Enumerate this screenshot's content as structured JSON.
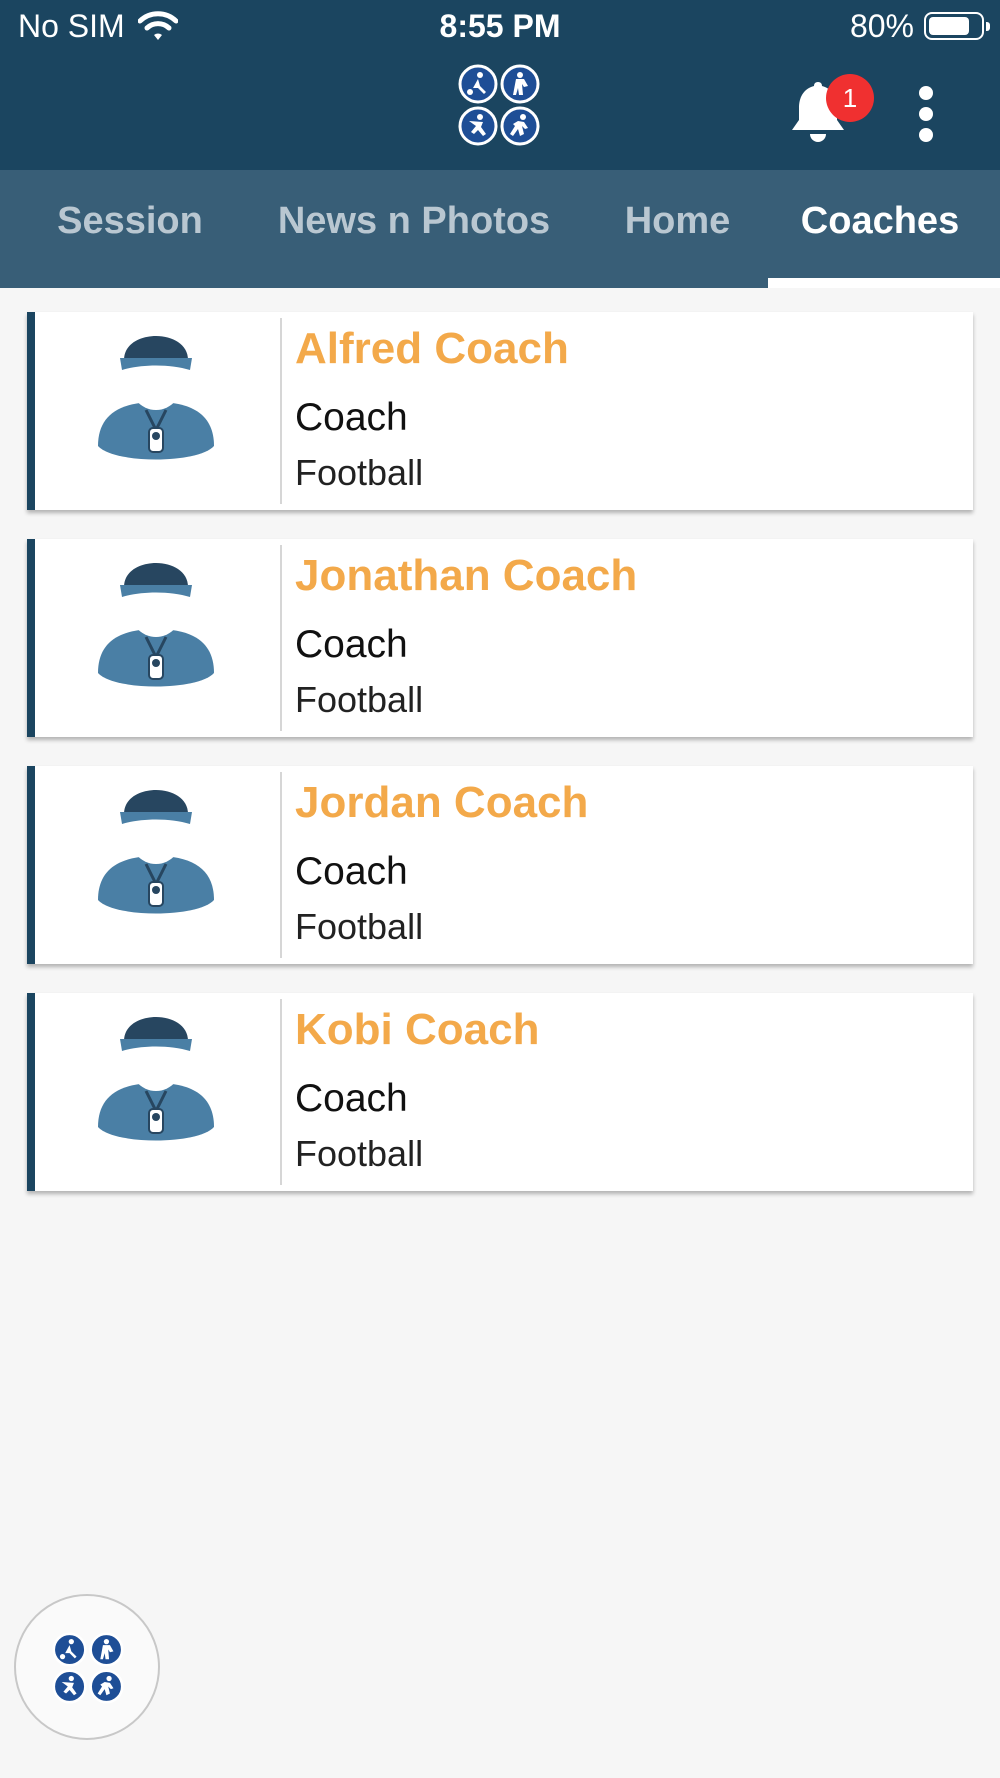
{
  "status_bar": {
    "carrier": "No SIM",
    "time": "8:55 PM",
    "battery_text": "80%",
    "battery_level": 0.8,
    "wifi_icon": "wifi-icon"
  },
  "app_bar": {
    "logo_icon": "sports-logo-icon",
    "notification_count": "1",
    "bell_icon": "bell-icon",
    "menu_icon": "more-vertical-icon"
  },
  "tabs": [
    {
      "label": "Session"
    },
    {
      "label": "News n Photos"
    },
    {
      "label": "Home"
    },
    {
      "label": "Coaches",
      "active": true
    }
  ],
  "coaches": [
    {
      "name": "Alfred Coach",
      "role": "Coach",
      "sport": "Football"
    },
    {
      "name": "Jonathan Coach",
      "role": "Coach",
      "sport": "Football"
    },
    {
      "name": "Jordan Coach",
      "role": "Coach",
      "sport": "Football"
    },
    {
      "name": "Kobi Coach",
      "role": "Coach",
      "sport": "Football"
    }
  ],
  "fab": {
    "icon": "sports-logo-icon"
  },
  "colors": {
    "header": "#1b4560",
    "tabbar": "#385e77",
    "accent_name": "#f3a94a",
    "badge": "#f03030",
    "avatar_body": "#4a7fa5"
  }
}
